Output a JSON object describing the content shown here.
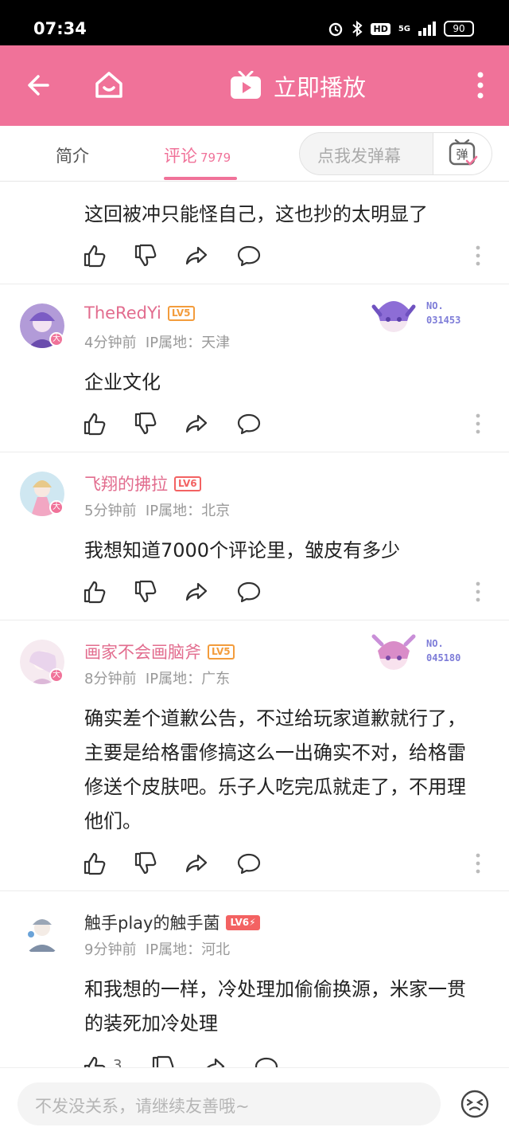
{
  "status": {
    "time": "07:34",
    "battery": "90",
    "network": "5G",
    "hd": "HD"
  },
  "topbar": {
    "title": "立即播放"
  },
  "tabs": {
    "intro": "简介",
    "comments": "评论",
    "comments_count": "7979"
  },
  "danmu": {
    "placeholder": "点我发弹幕",
    "button": "弹"
  },
  "comments": [
    {
      "text": "这回被冲只能怪自己，这也抄的太明显了"
    },
    {
      "username": "TheRedYi",
      "level": "LV5",
      "time": "4分钟前",
      "ip": "IP属地：天津",
      "text": "企业文化",
      "fan_no": "NO.\n031453"
    },
    {
      "username": "飞翔的拂拉",
      "level": "LV6",
      "time": "5分钟前",
      "ip": "IP属地：北京",
      "text": "我想知道7000个评论里，皱皮有多少"
    },
    {
      "username": "画家不会画脑斧",
      "level": "LV5",
      "time": "8分钟前",
      "ip": "IP属地：广东",
      "text": "确实差个道歉公告，不过给玩家道歉就行了，主要是给格雷修搞这么一出确实不对，给格雷修送个皮肤吧。乐子人吃完瓜就走了，不用理他们。",
      "fan_no": "NO.\n045180"
    },
    {
      "username": "触手play的触手菌",
      "level": "LV6⚡",
      "time": "9分钟前",
      "ip": "IP属地：河北",
      "text": "和我想的一样，冷处理加偷偷换源，米家一贯的装死加冷处理",
      "likes": "3"
    }
  ],
  "badge": "大",
  "bottom": {
    "placeholder": "不发没关系，请继续友善哦~"
  },
  "colors": {
    "accent": "#f07299",
    "lv5": "#f39c3c",
    "lv6": "#f36262"
  }
}
